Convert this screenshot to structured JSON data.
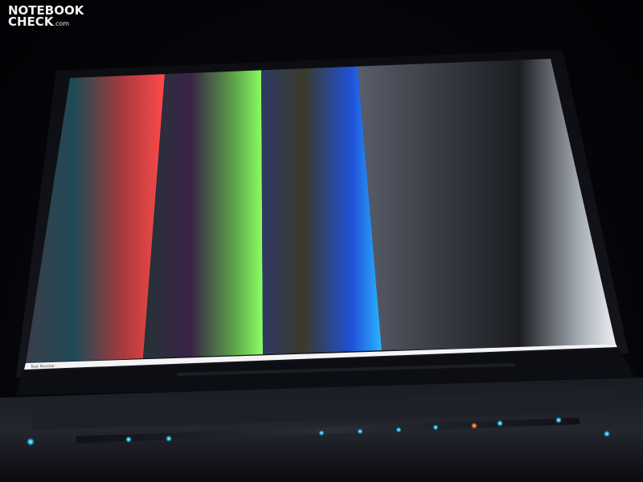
{
  "watermark": {
    "line1": "NOTEBOOK",
    "line2": "CHECK",
    "suffix": ".com"
  },
  "screen": {
    "taskbar_label": "Test Review",
    "bands": [
      {
        "name": "red-gradient",
        "end_color": "#ff4a4a"
      },
      {
        "name": "green-gradient",
        "end_color": "#8cff62"
      },
      {
        "name": "blue-gradient",
        "end_color": "#2ab4ff"
      },
      {
        "name": "gray-gradient",
        "end_color": "#f4f6f8"
      }
    ]
  },
  "control_bar": {
    "indicator_color": "#22ccff",
    "accent_color": "#ff6a22"
  }
}
